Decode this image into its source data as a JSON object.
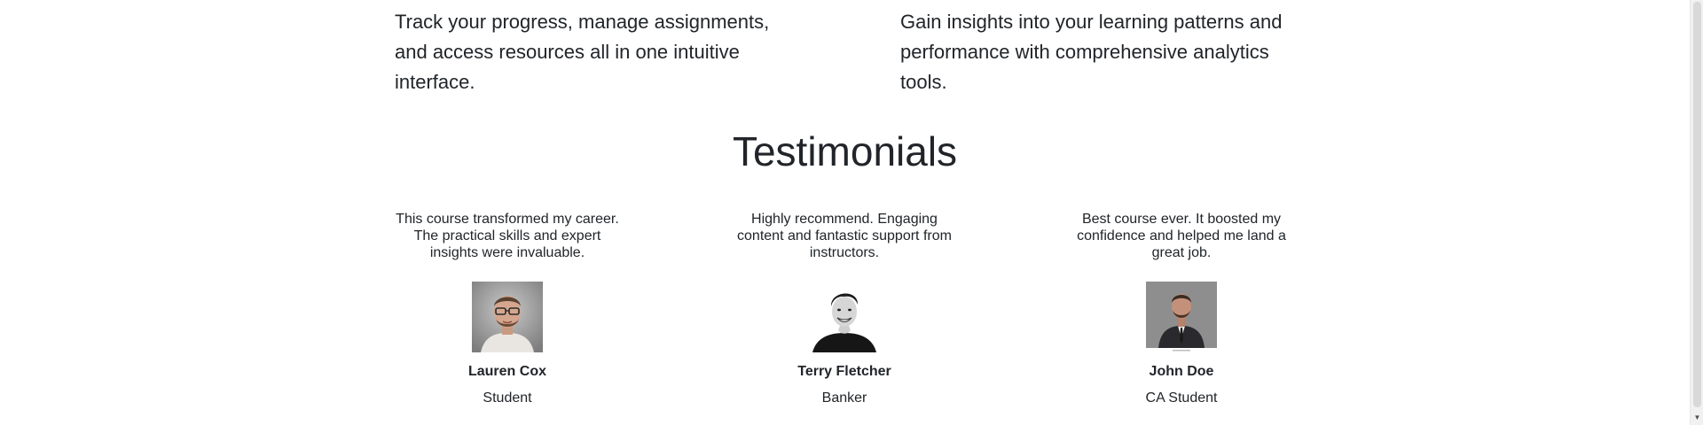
{
  "features": {
    "left": "Track your progress, manage assignments, and access resources all in one intuitive interface.",
    "right": "Gain insights into your learning patterns and performance with comprehensive analytics tools."
  },
  "testimonials": {
    "title": "Testimonials",
    "items": [
      {
        "quote": "This course transformed my career. The practical skills and expert insights were invaluable.",
        "name": "Lauren Cox",
        "role": "Student",
        "avatar": "portrait-glasses-photo"
      },
      {
        "quote": "Highly recommend. Engaging content and fantastic support from instructors.",
        "name": "Terry Fletcher",
        "role": "Banker",
        "avatar": "portrait-smiling-bw-photo"
      },
      {
        "quote": "Best course ever. It boosted my confidence and helped me land a great job.",
        "name": "John Doe",
        "role": "CA Student",
        "avatar": "portrait-suit-photo"
      }
    ]
  },
  "scrollbar": {
    "down_icon": "chevron-down-icon"
  }
}
